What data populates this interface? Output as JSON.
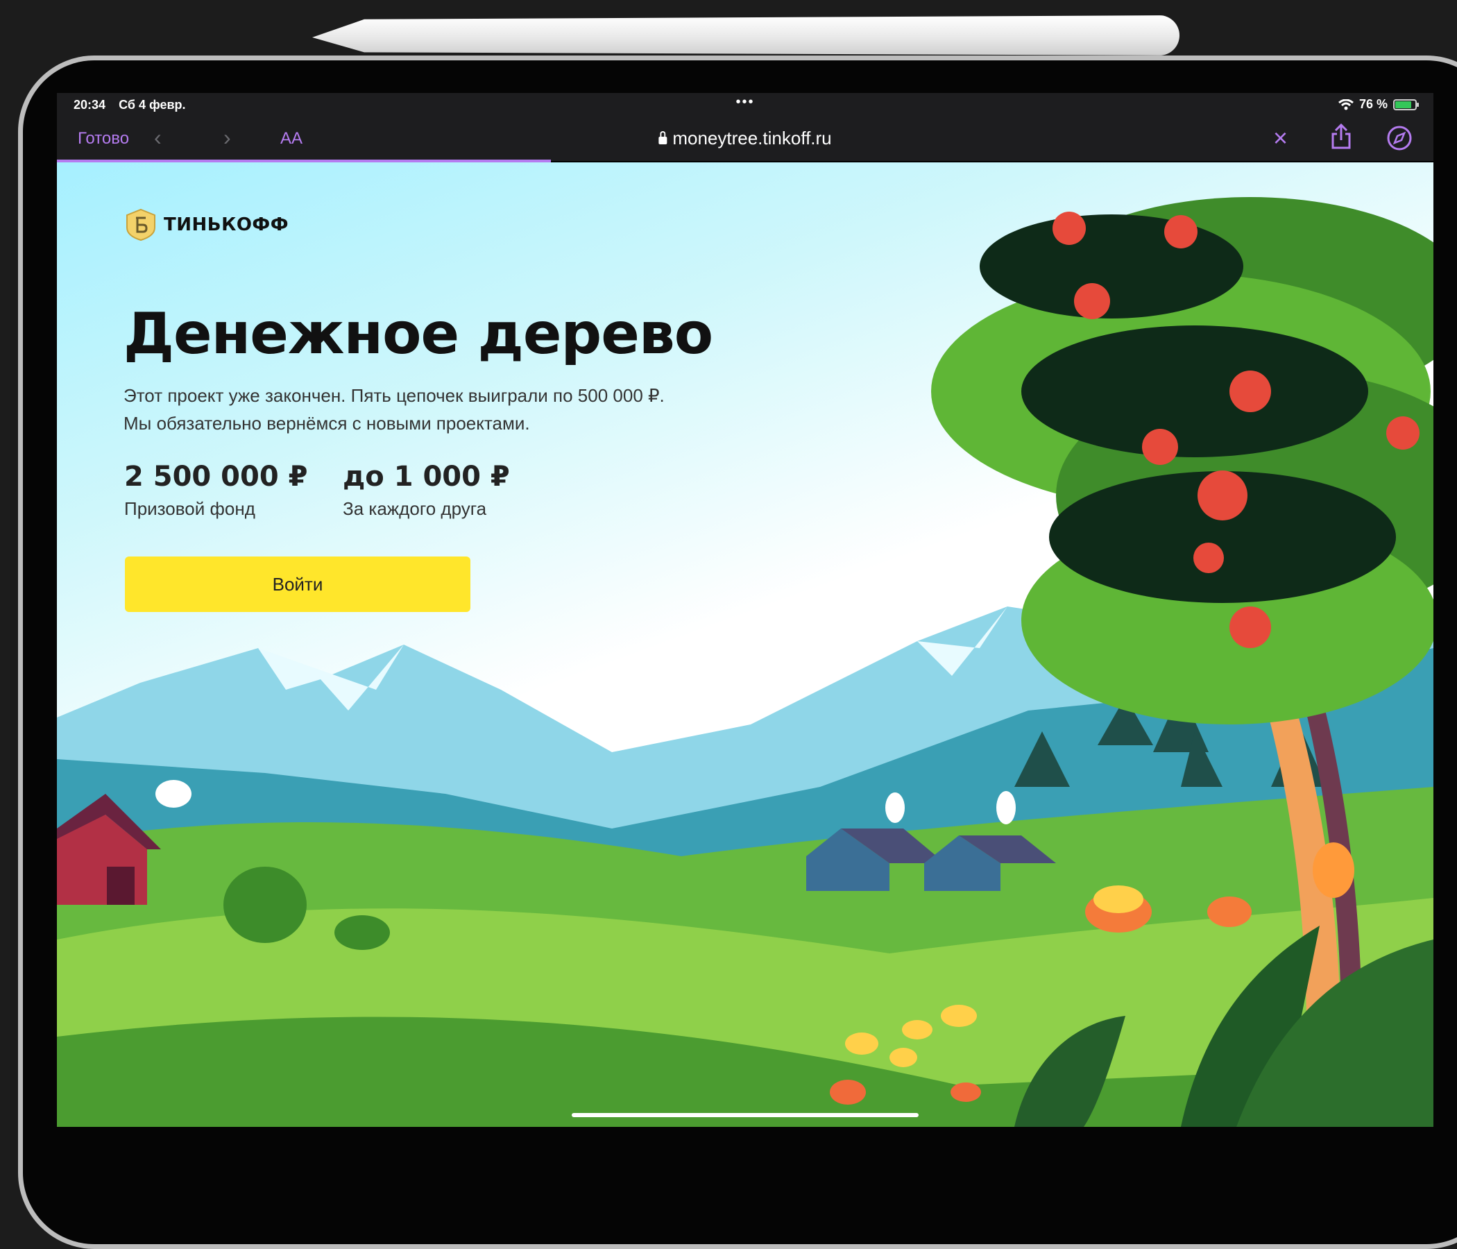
{
  "status_bar": {
    "time": "20:34",
    "date": "Сб 4 февр.",
    "dots": "•••",
    "battery": "76 %"
  },
  "toolbar": {
    "done_label": "Готово",
    "back_icon": "chevron-left-icon",
    "forward_icon": "chevron-right-icon",
    "text_size_label": "AA",
    "url": "moneytree.tinkoff.ru",
    "close_icon": "close-icon",
    "share_icon": "share-icon",
    "compass_icon": "compass-icon",
    "accent_color": "#b57cf0"
  },
  "page": {
    "brand": "ТИНЬКОФФ",
    "title": "Денежное дерево",
    "description_line1": "Этот проект уже закончен. Пять цепочек выиграли по 500 000 ₽.",
    "description_line2": "Мы обязательно вернёмся с новыми проектами.",
    "stats": [
      {
        "value": "2 500 000 ₽",
        "label": "Призовой фонд"
      },
      {
        "value": "до 1 000 ₽",
        "label": "За каждого друга"
      }
    ],
    "login_label": "Войти",
    "button_color": "#ffe62b"
  }
}
